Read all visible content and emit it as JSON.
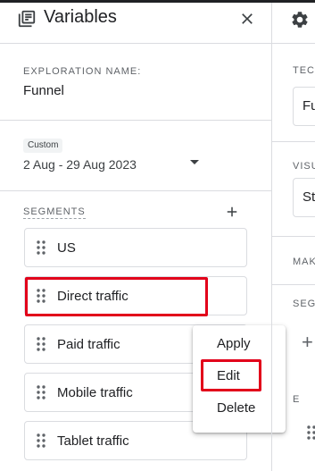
{
  "panel": {
    "title": "Variables",
    "exploration_name_label": "EXPLORATION NAME:",
    "exploration_name_value": "Funnel",
    "date_chip": "Custom",
    "date_range": "2 Aug - 29 Aug 2023",
    "segments_label": "SEGMENTS",
    "segments": [
      {
        "label": "US"
      },
      {
        "label": "Direct traffic"
      },
      {
        "label": "Paid traffic"
      },
      {
        "label": "Mobile traffic"
      },
      {
        "label": "Tablet traffic"
      }
    ]
  },
  "context_menu": {
    "items": [
      {
        "label": "Apply"
      },
      {
        "label": "Edit"
      },
      {
        "label": "Delete"
      }
    ]
  },
  "right_panel": {
    "technique_label": "TEC",
    "technique_value": "Fu",
    "visualization_label": "VISU",
    "visualization_value": "St",
    "make_label": "MAK",
    "segment_compare_label": "SEG",
    "partial_label": "E"
  },
  "colors": {
    "highlight": "#e2001a",
    "divider": "#dadce0",
    "text": "#202124",
    "muted": "#5f6368"
  },
  "icons": [
    "list-icon",
    "close-icon",
    "dropdown-arrow-icon",
    "plus-icon",
    "drag-handle-icon",
    "settings-icon"
  ]
}
